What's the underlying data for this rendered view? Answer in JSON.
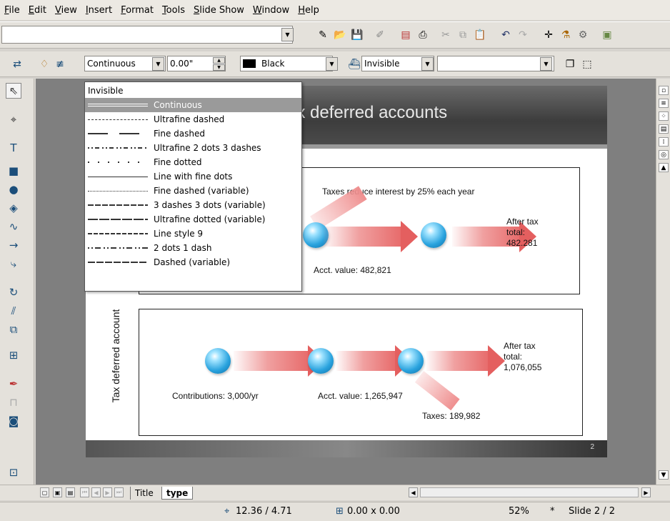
{
  "menu": [
    "File",
    "Edit",
    "View",
    "Insert",
    "Format",
    "Tools",
    "Slide Show",
    "Window",
    "Help"
  ],
  "toolbar1": {
    "url_value": ""
  },
  "line_toolbar": {
    "line_style": "Continuous",
    "line_width": "0.00\"",
    "line_color": "Black",
    "line_color_hex": "#000000",
    "area_style": "Invisible",
    "area_fill": ""
  },
  "line_style_list": {
    "items": [
      "Invisible",
      "Continuous",
      "Ultrafine dashed",
      "Fine dashed",
      "Ultrafine 2 dots 3 dashes",
      "Fine dotted",
      "Line with fine dots",
      "Fine dashed (variable)",
      "3 dashes 3 dots (variable)",
      "Ultrafine dotted (variable)",
      "Line style 9",
      "2 dots 1 dash",
      "Dashed (variable)"
    ],
    "selected": "Continuous"
  },
  "slide": {
    "title": "Tax deferred accounts",
    "page_number": "2",
    "panel_top": {
      "annotation": "Taxes reduce interest by 25% each  year",
      "acct_value": "Acct. value: 482,821",
      "after_tax": "After tax\ntotal:\n482.281"
    },
    "panel_bottom": {
      "side_label": "Tax deferred account",
      "contributions": "Contributions: 3,000/yr",
      "acct_value": "Acct. value: 1,265,947",
      "after_tax": "After tax\ntotal:\n1,076,055",
      "taxes": "Taxes: 189,982"
    }
  },
  "tabs": [
    "Title",
    "type"
  ],
  "active_tab": "type",
  "status": {
    "position": "12.36 / 4.71",
    "size": "0.00 x 0.00",
    "zoom": "52%",
    "modified": "*",
    "slide": "Slide 2 / 2"
  },
  "colors": {
    "accent_sphere": "#2aa3de",
    "arrow": "#e45f5f",
    "selection": "#9a9a9a"
  }
}
